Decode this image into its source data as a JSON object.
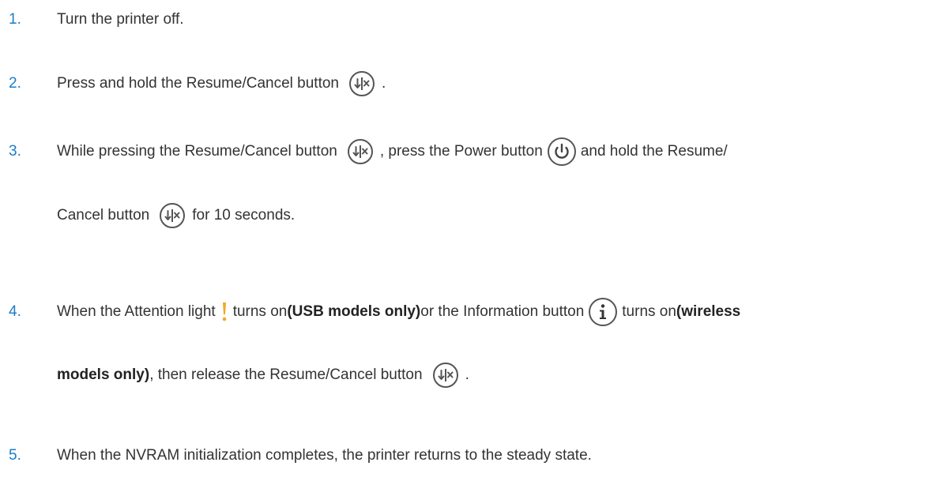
{
  "steps": [
    {
      "number": "1.",
      "lines": [
        [
          {
            "t": "text",
            "v": "Turn the printer off."
          }
        ]
      ]
    },
    {
      "number": "2.",
      "lines": [
        [
          {
            "t": "text",
            "v": "Press and hold the Resume/Cancel button"
          },
          {
            "t": "icon",
            "v": "resume-cancel"
          },
          {
            "t": "text",
            "v": "."
          }
        ]
      ]
    },
    {
      "number": "3.",
      "lines": [
        [
          {
            "t": "text",
            "v": "While pressing the Resume/Cancel button"
          },
          {
            "t": "icon",
            "v": "resume-cancel"
          },
          {
            "t": "text",
            "v": ", press the Power button"
          },
          {
            "t": "icon",
            "v": "power"
          },
          {
            "t": "text",
            "v": "and hold the Resume/"
          }
        ],
        [
          {
            "t": "text",
            "v": "Cancel button"
          },
          {
            "t": "icon",
            "v": "resume-cancel"
          },
          {
            "t": "text",
            "v": "for 10 seconds."
          }
        ]
      ]
    },
    {
      "number": "4.",
      "lines": [
        [
          {
            "t": "text",
            "v": "When the Attention light"
          },
          {
            "t": "icon",
            "v": "attention"
          },
          {
            "t": "text",
            "v": "turns on "
          },
          {
            "t": "bold",
            "v": "(USB models only)"
          },
          {
            "t": "text",
            "v": " or the Information button"
          },
          {
            "t": "icon",
            "v": "information"
          },
          {
            "t": "text",
            "v": "turns on "
          },
          {
            "t": "bold",
            "v": "(wireless"
          }
        ],
        [
          {
            "t": "bold",
            "v": "models only)"
          },
          {
            "t": "text",
            "v": ", then release the Resume/Cancel button"
          },
          {
            "t": "icon",
            "v": "resume-cancel"
          },
          {
            "t": "text",
            "v": "."
          }
        ]
      ]
    },
    {
      "number": "5.",
      "lines": [
        [
          {
            "t": "text",
            "v": "When the NVRAM initialization completes, the printer returns to the steady state."
          }
        ]
      ]
    }
  ],
  "colors": {
    "step_number": "#1c7cc7",
    "attention": "#f5a623",
    "icon_stroke": "#555555"
  }
}
